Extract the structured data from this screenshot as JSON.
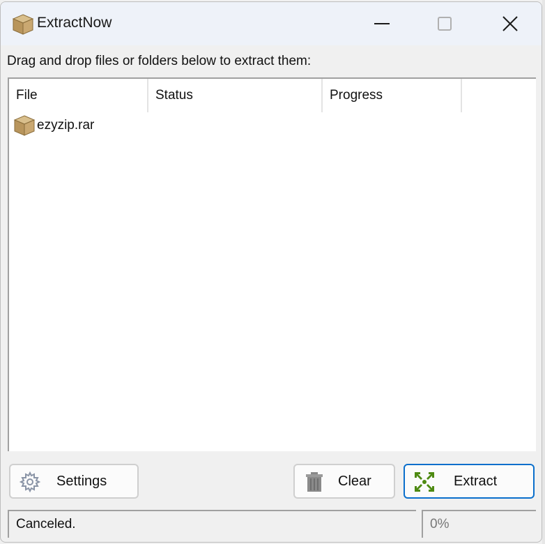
{
  "window": {
    "title": "ExtractNow",
    "app_icon": "package-box-icon",
    "controls": {
      "minimize": "minimize-icon",
      "maximize": "maximize-icon",
      "close": "close-icon"
    }
  },
  "instruction": "Drag and drop files or folders below to extract them:",
  "list": {
    "columns": [
      "File",
      "Status",
      "Progress",
      ""
    ],
    "rows": [
      {
        "file": "ezyzip.rar",
        "status": "",
        "progress": "",
        "icon": "archive-box-icon"
      }
    ]
  },
  "buttons": {
    "settings": {
      "label": "Settings",
      "icon": "gear-icon"
    },
    "clear": {
      "label": "Clear",
      "icon": "trash-icon"
    },
    "extract": {
      "label": "Extract",
      "icon": "expand-arrows-icon"
    }
  },
  "statusbar": {
    "message": "Canceled.",
    "progress_text": "0%"
  },
  "colors": {
    "accent": "#0a6fcc",
    "extract_icon": "#4e8a12"
  }
}
